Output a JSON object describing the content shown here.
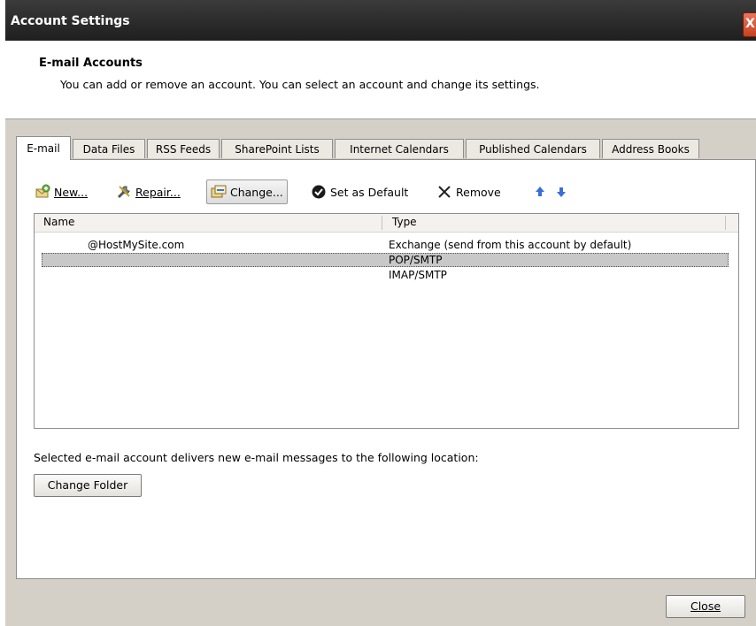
{
  "window": {
    "title": "Account Settings",
    "close_glyph": "X"
  },
  "header": {
    "title": "E-mail Accounts",
    "description": "You can add or remove an account. You can select an account and change its settings."
  },
  "tabs": [
    {
      "label": "E-mail",
      "active": true
    },
    {
      "label": "Data Files",
      "active": false
    },
    {
      "label": "RSS Feeds",
      "active": false
    },
    {
      "label": "SharePoint Lists",
      "active": false
    },
    {
      "label": "Internet Calendars",
      "active": false
    },
    {
      "label": "Published Calendars",
      "active": false
    },
    {
      "label": "Address Books",
      "active": false
    }
  ],
  "toolbar": {
    "new_label": "New...",
    "repair_label": "Repair...",
    "change_label": "Change...",
    "set_default_label": "Set as Default",
    "remove_label": "Remove",
    "icons": [
      "new-account-icon",
      "repair-icon",
      "change-icon",
      "check-circle-icon",
      "remove-x-icon",
      "arrow-up-icon",
      "arrow-down-icon"
    ]
  },
  "accounts_list": {
    "columns": [
      "Name",
      "Type"
    ],
    "rows": [
      {
        "name": "@HostMySite.com",
        "type": "Exchange (send from this account by default)",
        "selected": false
      },
      {
        "name": "",
        "type": "POP/SMTP",
        "selected": true
      },
      {
        "name": "",
        "type": "IMAP/SMTP",
        "selected": false
      }
    ]
  },
  "delivery": {
    "text": "Selected e-mail account delivers new e-mail messages to the following location:",
    "change_folder_label": "Change Folder"
  },
  "footer": {
    "close_label": "Close"
  },
  "colors": {
    "titlebar": "#2a2a2a",
    "dialog_bg": "#d4d0c8",
    "selection": "#c8c8c8",
    "arrow_blue": "#3a6fd8"
  }
}
